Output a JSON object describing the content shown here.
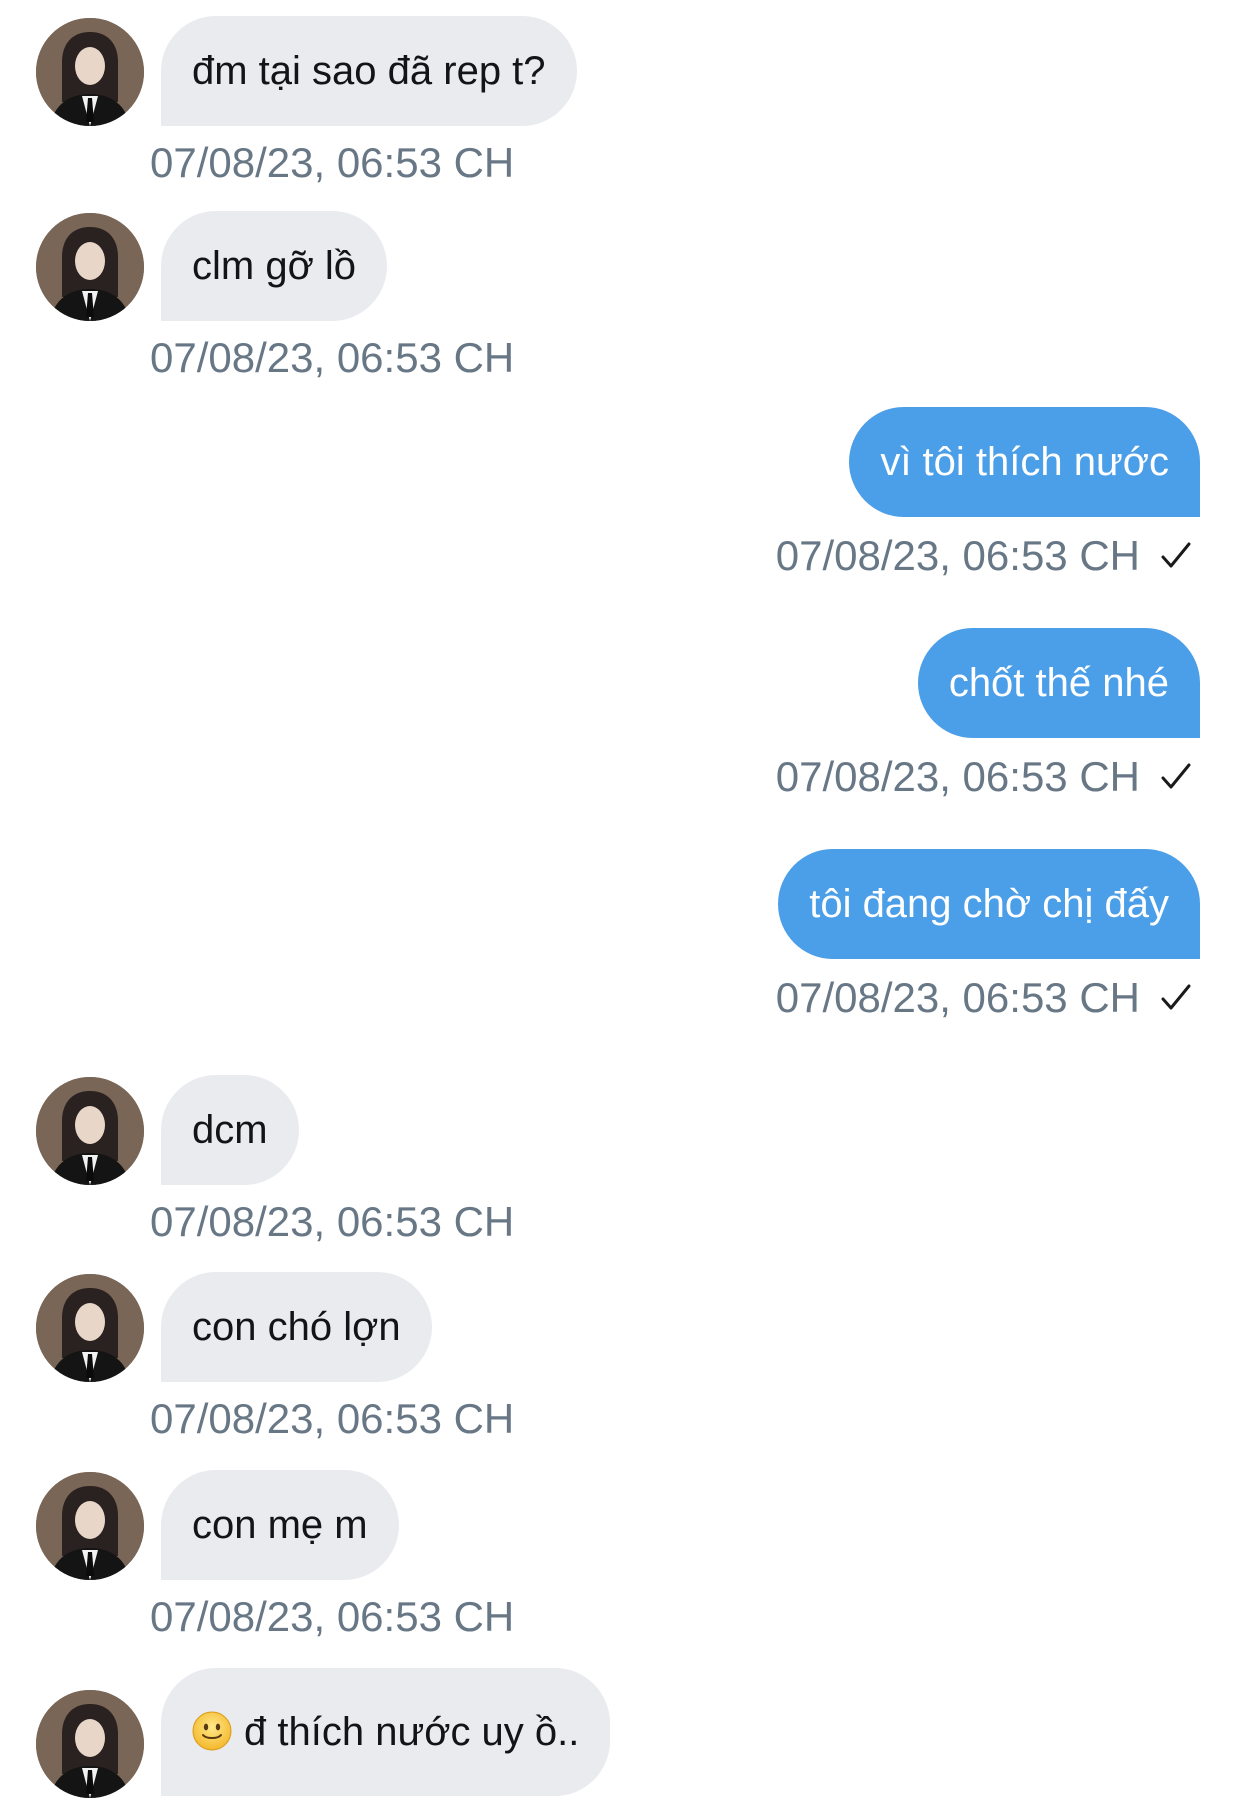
{
  "conversation": {
    "messages": [
      {
        "sender": "them",
        "text": "đm tại sao đã rep t?",
        "time": "07/08/23, 06:53 CH"
      },
      {
        "sender": "them",
        "text": "clm gỡ lồ",
        "time": "07/08/23, 06:53 CH"
      },
      {
        "sender": "me",
        "text": "vì tôi thích nước",
        "time": "07/08/23, 06:53 CH",
        "status_icon": "checkmark-icon"
      },
      {
        "sender": "me",
        "text": "chốt thế nhé",
        "time": "07/08/23, 06:53 CH",
        "status_icon": "checkmark-icon"
      },
      {
        "sender": "me",
        "text": "tôi đang chờ chị đấy",
        "time": "07/08/23, 06:53 CH",
        "status_icon": "checkmark-icon"
      },
      {
        "sender": "them",
        "text": "dcm",
        "time": "07/08/23, 06:53 CH"
      },
      {
        "sender": "them",
        "text": "con chó lợn",
        "time": "07/08/23, 06:53 CH"
      },
      {
        "sender": "them",
        "text": "con mẹ m",
        "time": "07/08/23, 06:53 CH"
      },
      {
        "sender": "them",
        "text": "đ thích nước uy ồ..",
        "emoji": "slightly-smiling-face-icon",
        "time": ""
      }
    ]
  },
  "colors": {
    "incoming_bubble": "#e9ebef",
    "outgoing_bubble": "#4b9ee8",
    "timestamp_text": "#687785",
    "incoming_text": "#111418",
    "outgoing_text": "#ffffff"
  }
}
